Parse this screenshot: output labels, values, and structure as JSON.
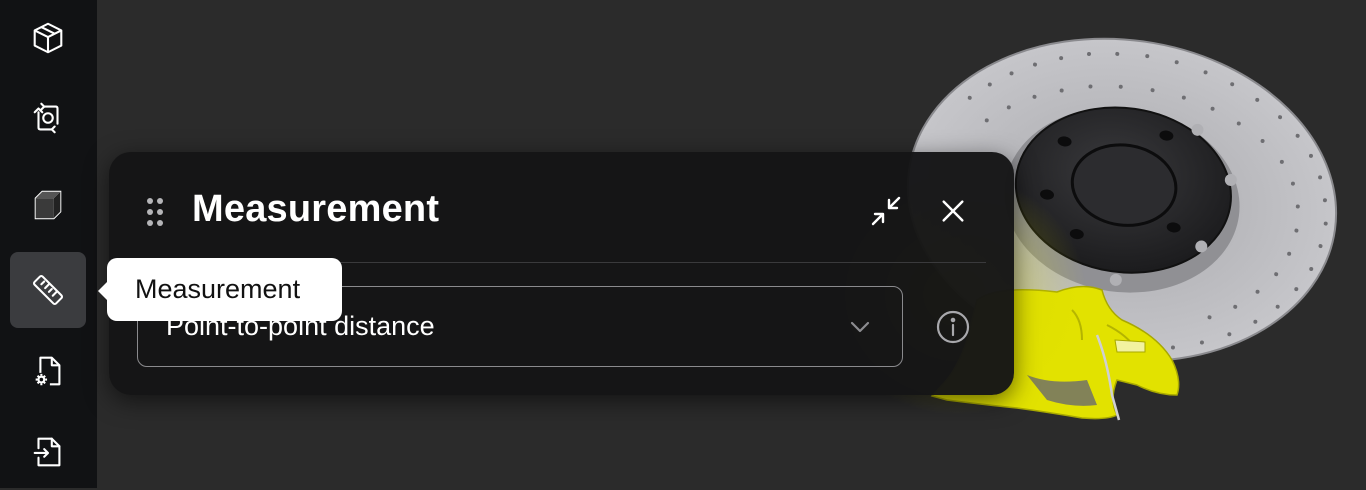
{
  "sidebar": {
    "items": [
      {
        "name": "cube-outline-icon",
        "active": false
      },
      {
        "name": "rotate-view-icon",
        "active": false
      },
      {
        "name": "solid-cube-icon",
        "active": false
      },
      {
        "name": "ruler-icon",
        "active": true
      },
      {
        "name": "file-settings-icon",
        "active": false
      },
      {
        "name": "file-export-icon",
        "active": false
      }
    ]
  },
  "tooltip": {
    "label": "Measurement"
  },
  "panel": {
    "title": "Measurement",
    "dropdown": {
      "selected": "Point-to-point distance"
    }
  },
  "colors": {
    "sidebar": "#111214",
    "viewport": "#2b2b2b",
    "panel": "#151516",
    "highlight": "#e6e600"
  }
}
